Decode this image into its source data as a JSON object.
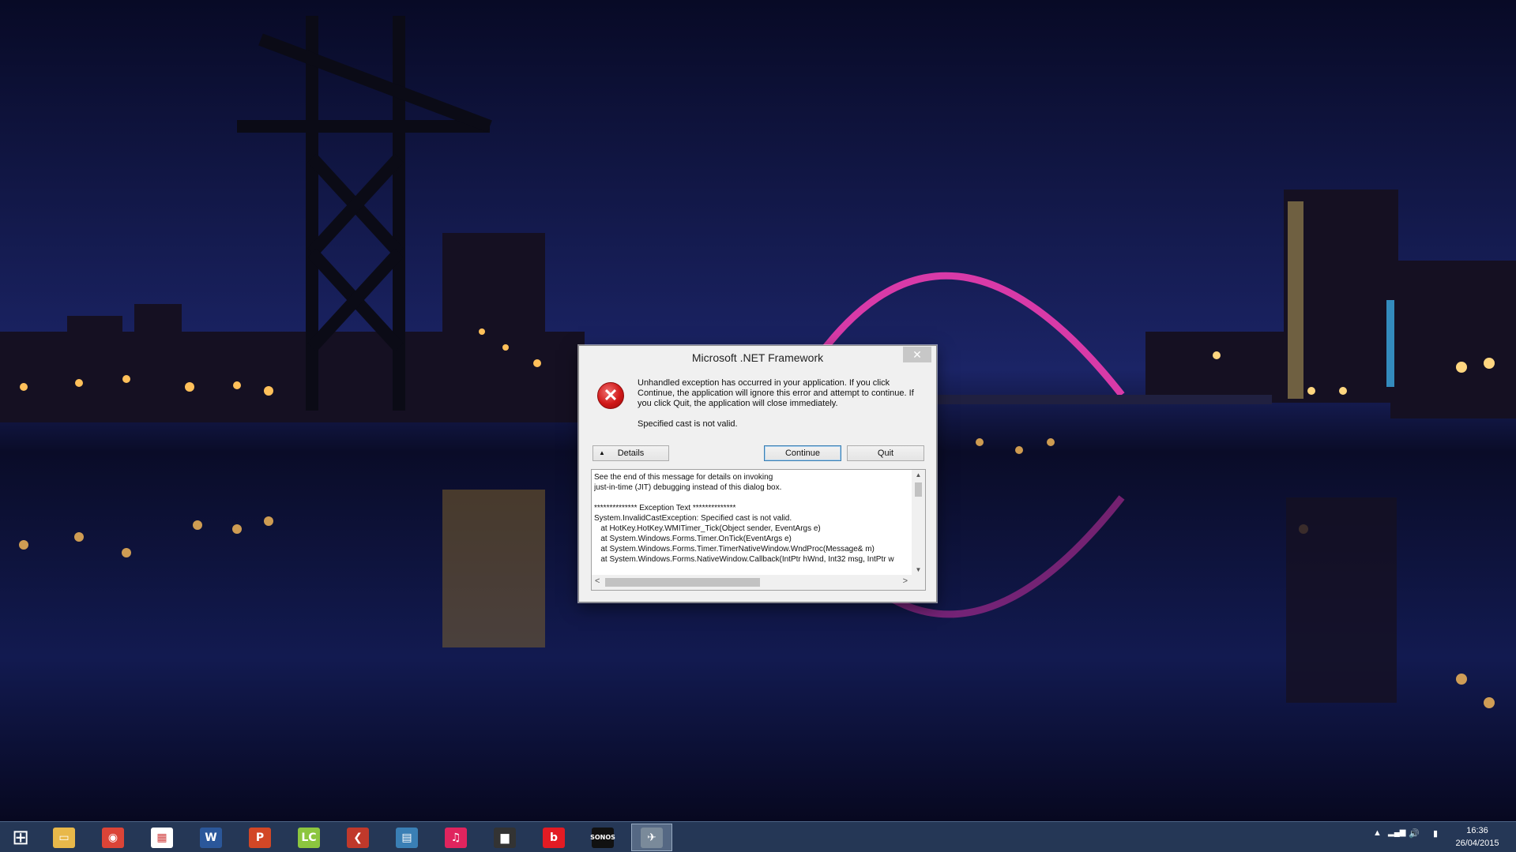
{
  "dialog": {
    "title": "Microsoft .NET Framework",
    "close_glyph": "✕",
    "error_icon": "error-x-icon",
    "message": "Unhandled exception has occurred in your application. If you click Continue, the application will ignore this error and attempt to continue. If you click Quit, the application will close immediately.",
    "sub_message": "Specified cast is not valid.",
    "details_label": "Details",
    "details_arrow": "▲",
    "continue_label": "Continue",
    "quit_label": "Quit",
    "details_text": "See the end of this message for details on invoking\njust-in-time (JIT) debugging instead of this dialog box.\n\n************** Exception Text **************\nSystem.InvalidCastException: Specified cast is not valid.\n   at HotKey.HotKey.WMITimer_Tick(Object sender, EventArgs e)\n   at System.Windows.Forms.Timer.OnTick(EventArgs e)\n   at System.Windows.Forms.Timer.TimerNativeWindow.WndProc(Message& m)\n   at System.Windows.Forms.NativeWindow.Callback(IntPtr hWnd, Int32 msg, IntPtr w",
    "scroll_up": "▲",
    "scroll_down": "▼",
    "scroll_left": "<",
    "scroll_right": ">"
  },
  "taskbar": {
    "items": [
      {
        "icon": "windows-start-icon",
        "glyph": "⊞",
        "color": "transparent"
      },
      {
        "icon": "file-explorer-icon",
        "glyph": "▭",
        "color": "#e8b84a"
      },
      {
        "icon": "chrome-icon",
        "glyph": "◉",
        "color": "#db4437"
      },
      {
        "icon": "store-apps-icon",
        "glyph": "▦",
        "color": "#ffffff"
      },
      {
        "icon": "word-icon",
        "glyph": "W",
        "color": "#2b579a"
      },
      {
        "icon": "powerpoint-icon",
        "glyph": "P",
        "color": "#d24726"
      },
      {
        "icon": "lc-app-icon",
        "glyph": "LC",
        "color": "#8cc63f"
      },
      {
        "icon": "red-arrow-app-icon",
        "glyph": "❮",
        "color": "#c0392b"
      },
      {
        "icon": "video-app-icon",
        "glyph": "▤",
        "color": "#3a7fb5"
      },
      {
        "icon": "itunes-icon",
        "glyph": "♫",
        "color": "#e0245e"
      },
      {
        "icon": "equalizer-app-icon",
        "glyph": "▆",
        "color": "#333333"
      },
      {
        "icon": "beats-icon",
        "glyph": "b",
        "color": "#e31b23"
      },
      {
        "icon": "sonos-icon",
        "glyph": "SONOS",
        "color": "#111111"
      },
      {
        "icon": "hotkey-app-icon",
        "glyph": "✈",
        "color": "#7a8a9a"
      }
    ],
    "tray": {
      "up_arrow": "▲",
      "signal": "▂▄▆",
      "volume": "🔊",
      "battery": "▮"
    },
    "time": "16:36",
    "date": "26/04/2015"
  },
  "colors": {
    "sky_top": "#0a0c2e",
    "sky_horizon": "#1a2262",
    "bridge": "#d83aa8",
    "lights": "#ffc05a"
  }
}
